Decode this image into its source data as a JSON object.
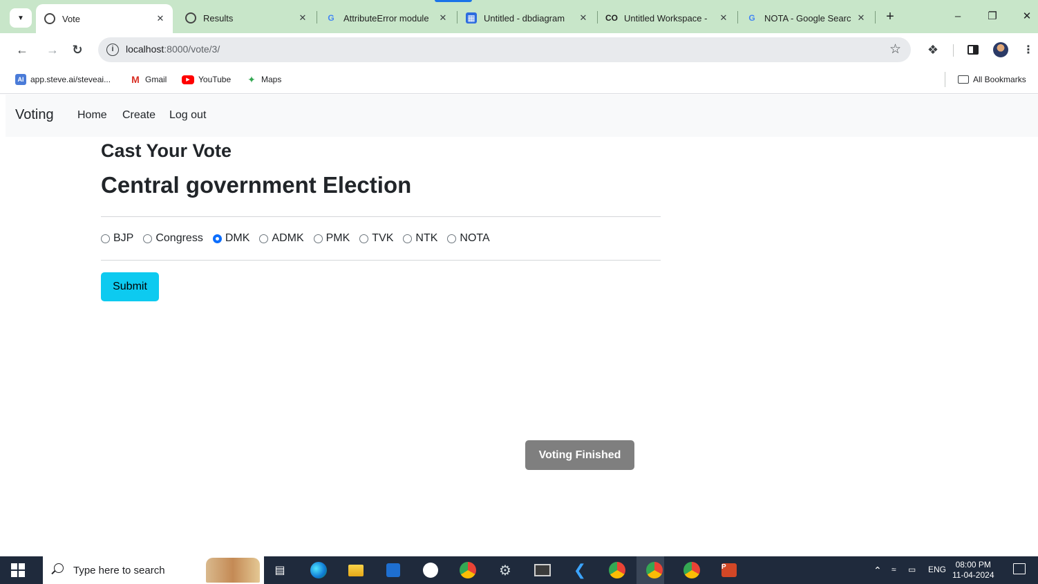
{
  "browser": {
    "tabs": [
      {
        "title": "Vote",
        "active": true
      },
      {
        "title": "Results",
        "active": false
      },
      {
        "title": "AttributeError module",
        "active": false
      },
      {
        "title": "Untitled - dbdiagram",
        "active": false
      },
      {
        "title": "Untitled Workspace -",
        "active": false
      },
      {
        "title": "NOTA - Google Searc",
        "active": false
      }
    ],
    "address": {
      "host": "localhost",
      "path": ":8000/vote/3/"
    },
    "bookmarks": [
      {
        "label": "app.steve.ai/steveai...",
        "icon": "ai-icon"
      },
      {
        "label": "Gmail",
        "icon": "gmail-icon"
      },
      {
        "label": "YouTube",
        "icon": "youtube-icon"
      },
      {
        "label": "Maps",
        "icon": "maps-icon"
      }
    ],
    "all_bookmarks": "All Bookmarks"
  },
  "navbar": {
    "brand": "Voting",
    "links": [
      "Home",
      "Create",
      "Log out"
    ]
  },
  "main": {
    "heading": "Cast Your Vote",
    "election_title": "Central government Election",
    "options": [
      {
        "label": "BJP",
        "checked": false
      },
      {
        "label": "Congress",
        "checked": false
      },
      {
        "label": "DMK",
        "checked": true
      },
      {
        "label": "ADMK",
        "checked": false
      },
      {
        "label": "PMK",
        "checked": false
      },
      {
        "label": "TVK",
        "checked": false
      },
      {
        "label": "NTK",
        "checked": false
      },
      {
        "label": "NOTA",
        "checked": false
      }
    ],
    "submit_label": "Submit",
    "status_label": "Voting Finished"
  },
  "taskbar": {
    "search_placeholder": "Type here to search",
    "language": "ENG",
    "time": "08:00 PM",
    "date": "11-04-2024"
  },
  "colors": {
    "tab_strip": "#c8e6c9",
    "submit_button": "#0dcaf0",
    "status_badge": "#7f7f7f",
    "radio_checked": "#0d6efd"
  }
}
